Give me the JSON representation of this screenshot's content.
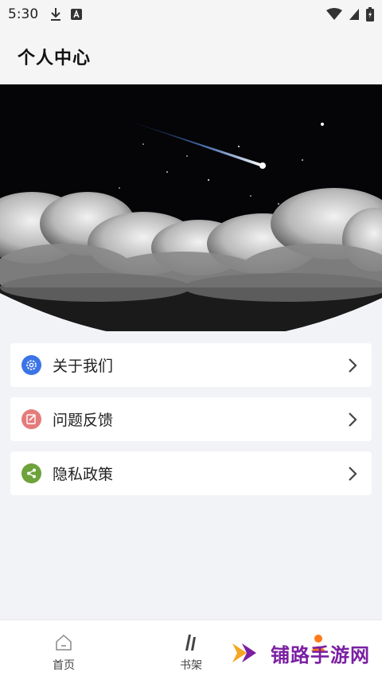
{
  "status_bar": {
    "time": "5:30"
  },
  "header": {
    "title": "个人中心"
  },
  "menu": {
    "items": [
      {
        "label": "关于我们",
        "icon": "gear-icon",
        "color": "#3b74e6"
      },
      {
        "label": "问题反馈",
        "icon": "feedback-icon",
        "color": "#e57b7b"
      },
      {
        "label": "隐私政策",
        "icon": "share-icon",
        "color": "#6ea23a"
      }
    ]
  },
  "tabbar": {
    "tabs": [
      {
        "label": "首页",
        "icon": "home-icon"
      },
      {
        "label": "书架",
        "icon": "bookshelf-icon"
      },
      {
        "label": "",
        "icon": "profile-icon"
      }
    ],
    "active_color": "#ff7a1a"
  },
  "watermark": {
    "text": "铺路手游网"
  }
}
